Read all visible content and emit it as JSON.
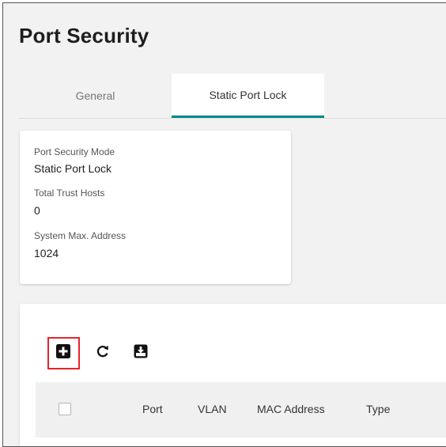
{
  "page": {
    "title": "Port Security"
  },
  "tabs": [
    {
      "label": "General",
      "active": false
    },
    {
      "label": "Static Port Lock",
      "active": true
    }
  ],
  "info": {
    "mode_label": "Port Security Mode",
    "mode_value": "Static Port Lock",
    "hosts_label": "Total Trust Hosts",
    "hosts_value": "0",
    "max_label": "System Max. Address",
    "max_value": "1024"
  },
  "toolbar": {
    "icons": [
      "add-icon",
      "refresh-icon",
      "export-icon"
    ]
  },
  "table": {
    "columns": [
      "Port",
      "VLAN",
      "MAC Address",
      "Type"
    ]
  },
  "colors": {
    "accent": "#008787",
    "highlight": "#e8232a"
  }
}
